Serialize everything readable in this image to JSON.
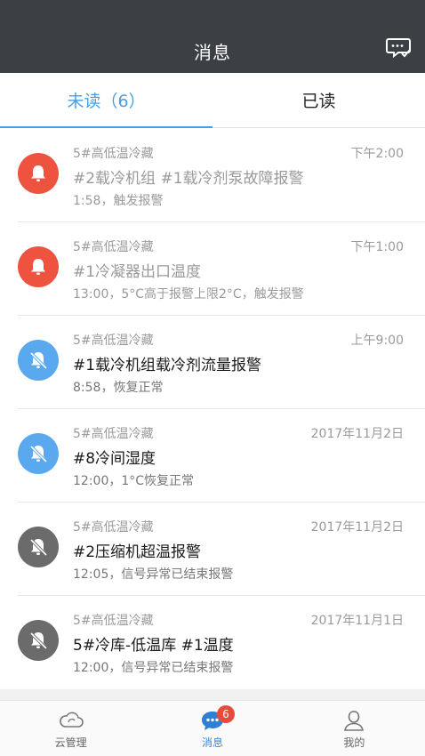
{
  "header": {
    "title": "消息"
  },
  "tabs": {
    "unread": "未读（6）",
    "read": "已读"
  },
  "messages": [
    {
      "source": "5#高低温冷藏",
      "time": "下午2:00",
      "title": "#2载冷机组 #1载冷剂泵故障报警",
      "detail": "1:58，触发报警",
      "status": "alarm",
      "color": "#ee5340"
    },
    {
      "source": "5#高低温冷藏",
      "time": "下午1:00",
      "title": "#1冷凝器出口温度",
      "detail": "13:00，5°C高于报警上限2°C，触发报警",
      "status": "alarm",
      "color": "#ee5340"
    },
    {
      "source": "5#高低温冷藏",
      "time": "上午9:00",
      "title": "#1载冷机组载冷剂流量报警",
      "detail": "8:58，恢复正常",
      "status": "recovered",
      "color": "#5aa9ee"
    },
    {
      "source": "5#高低温冷藏",
      "time": "2017年11月2日",
      "title": "#8冷间湿度",
      "detail": "12:00，1°C恢复正常",
      "status": "recovered",
      "color": "#5aa9ee"
    },
    {
      "source": "5#高低温冷藏",
      "time": "2017年11月2日",
      "title": "#2压缩机超温报警",
      "detail": "12:05，信号异常已结束报警",
      "status": "ended",
      "color": "#6b6b6b"
    },
    {
      "source": "5#高低温冷藏",
      "time": "2017年11月1日",
      "title": "5#冷库-低温库 #1温度",
      "detail": "12:00，信号异常已结束报警",
      "status": "ended",
      "color": "#6b6b6b"
    }
  ],
  "bottom_nav": [
    {
      "label": "云管理",
      "icon": "cloud-icon"
    },
    {
      "label": "消息",
      "icon": "chat-icon",
      "badge": "6",
      "active": true
    },
    {
      "label": "我的",
      "icon": "user-icon"
    }
  ],
  "colors": {
    "header_bg": "#3c3f44",
    "accent": "#4a9ee0",
    "alarm": "#ee5340",
    "recovered": "#5aa9ee",
    "ended": "#6b6b6b"
  }
}
